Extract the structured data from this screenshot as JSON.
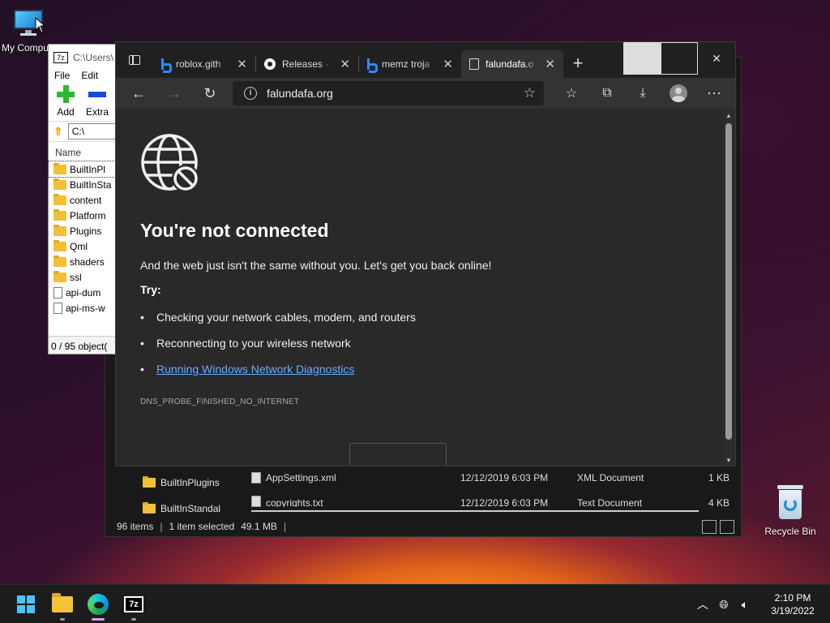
{
  "desktop": {
    "my_computer_label": "My Compu",
    "recycle_bin_label": "Recycle Bin"
  },
  "sevenzip": {
    "title_path": "C:\\Users\\",
    "logo": "7z",
    "menu": [
      "File",
      "Edit"
    ],
    "tools": {
      "add": "Add",
      "extract": "Extra"
    },
    "address": "C:\\",
    "column_name": "Name",
    "rows": [
      {
        "name": "BuiltInPl",
        "type": "folder"
      },
      {
        "name": "BuiltInSta",
        "type": "folder"
      },
      {
        "name": "content",
        "type": "folder"
      },
      {
        "name": "Platform",
        "type": "folder"
      },
      {
        "name": "Plugins",
        "type": "folder"
      },
      {
        "name": "Qml",
        "type": "folder"
      },
      {
        "name": "shaders",
        "type": "folder"
      },
      {
        "name": "ssl",
        "type": "folder"
      },
      {
        "name": "api-dum",
        "type": "file"
      },
      {
        "name": "api-ms-w",
        "type": "file"
      }
    ],
    "status": "0 / 95 object("
  },
  "explorer": {
    "nav": [
      "BuiltInPlugins",
      "BuiltInStandal"
    ],
    "files": [
      {
        "name": "AppSettings.xml",
        "date": "12/12/2019 6:03 PM",
        "type": "XML Document",
        "size": "1 KB"
      },
      {
        "name": "copyrights.txt",
        "date": "12/12/2019 6:03 PM",
        "type": "Text Document",
        "size": "4 KB"
      }
    ],
    "status": {
      "count": "96 items",
      "selected": "1 item selected",
      "size": "49.1 MB"
    }
  },
  "browser": {
    "tabs": [
      {
        "label": "roblox.gith",
        "icon": "bing-icon"
      },
      {
        "label": "Releases · R",
        "icon": "github-icon"
      },
      {
        "label": "memz troja",
        "icon": "bing-icon"
      },
      {
        "label": "falundafa.o",
        "icon": "page-error-icon",
        "active": true
      }
    ],
    "url": "falundafa.org",
    "error": {
      "title": "You're not connected",
      "subtitle": "And the web just isn't the same without you. Let's get you back online!",
      "try_label": "Try:",
      "suggestions": [
        "Checking your network cables, modem, and routers",
        "Reconnecting to your wireless network"
      ],
      "diagnostics_link": "Running Windows Network Diagnostics",
      "code": "DNS_PROBE_FINISHED_NO_INTERNET"
    }
  },
  "taskbar": {
    "time": "2:10 PM",
    "date": "3/19/2022",
    "sevenzip_label": "7z"
  }
}
